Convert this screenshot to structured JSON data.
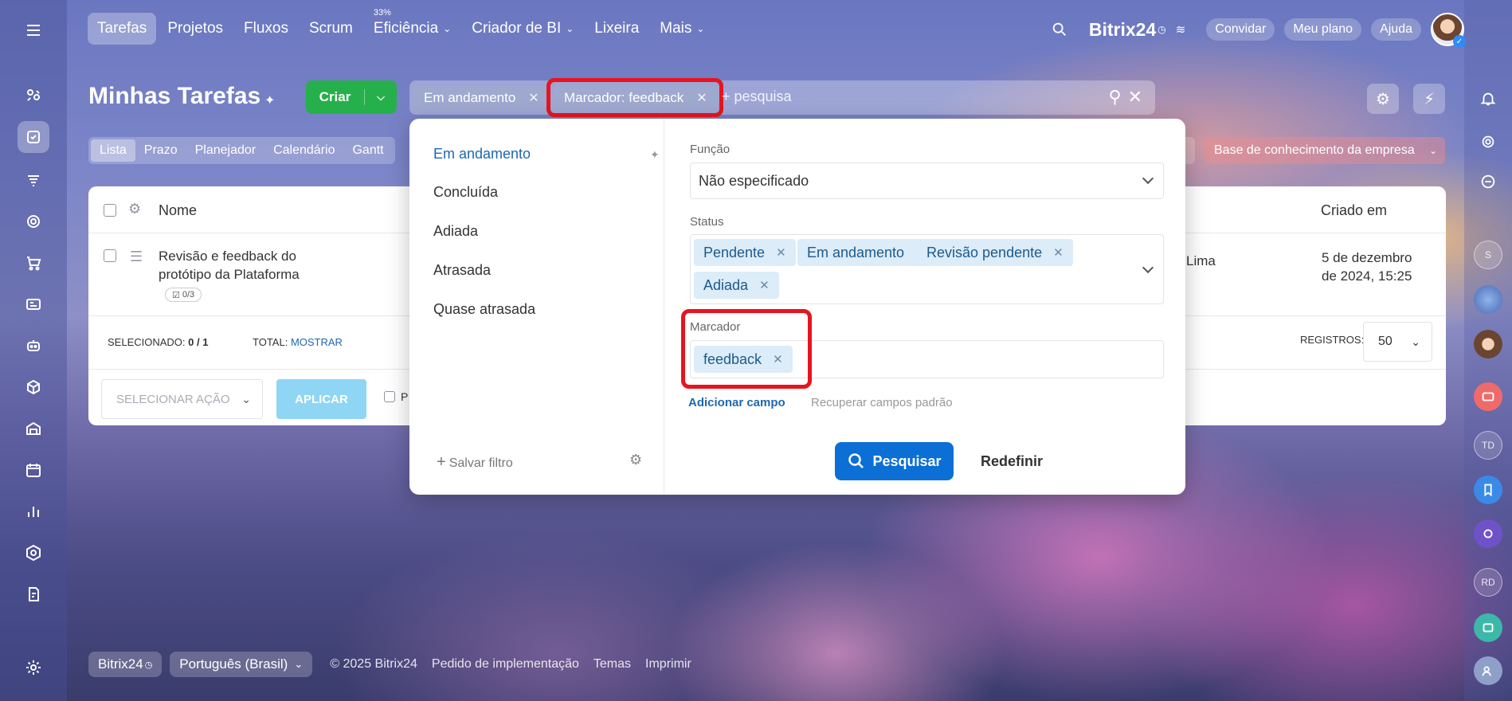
{
  "topnav": {
    "tabs": [
      {
        "label": "Tarefas",
        "active": true
      },
      {
        "label": "Projetos"
      },
      {
        "label": "Fluxos"
      },
      {
        "label": "Scrum"
      },
      {
        "label": "Eficiência",
        "sup": "33%",
        "caret": true
      },
      {
        "label": "Criador de BI",
        "caret": true
      },
      {
        "label": "Lixeira"
      },
      {
        "label": "Mais",
        "caret": true
      }
    ],
    "brand": "Bitrix24",
    "invite": "Convidar",
    "plan": "Meu plano",
    "help": "Ajuda"
  },
  "page": {
    "title": "Minhas Tarefas",
    "create": "Criar"
  },
  "filterbar": {
    "chip1": "Em andamento",
    "chip2": "Marcador: feedback",
    "placeholder": "+ pesquisa"
  },
  "viewtabs": [
    "Lista",
    "Prazo",
    "Planejador",
    "Calendário",
    "Gantt"
  ],
  "kb": "Base de conhecimento da empresa",
  "grid": {
    "col_name": "Nome",
    "col_created": "Criado em",
    "row_title_1": "Revisão e feedback do",
    "row_title_2": "protótipo da Plataforma",
    "row_subtasks": "0/3",
    "row_person": "Lima",
    "row_date_1": "5 de dezembro",
    "row_date_2": "de 2024, 15:25",
    "selected_label": "SELECIONADO:",
    "selected_value": "0 / 1",
    "total_label": "TOTAL:",
    "total_link": "MOSTRAR",
    "records_label": "REGISTROS:",
    "records_value": "50",
    "select_action": "SELECIONAR AÇÃO",
    "apply": "APLICAR",
    "partial_checkbox": "P"
  },
  "popup": {
    "presets": [
      "Em andamento",
      "Concluída",
      "Adiada",
      "Atrasada",
      "Quase atrasada"
    ],
    "save_filter": "Salvar filtro",
    "funcao_label": "Função",
    "funcao_value": "Não especificado",
    "status_label": "Status",
    "status_tags": [
      "Pendente",
      "Em andamento",
      "Revisão pendente",
      "Adiada"
    ],
    "marcador_label": "Marcador",
    "marcador_tag": "feedback",
    "add_field": "Adicionar campo",
    "restore_fields": "Recuperar campos padrão",
    "search": "Pesquisar",
    "reset": "Redefinir"
  },
  "right_bar": {
    "initials_1": "S",
    "initials_2": "TD",
    "initials_3": "RD"
  },
  "footer": {
    "brand": "Bitrix24",
    "language": "Português (Brasil)",
    "copyright": "© 2025 Bitrix24",
    "link1": "Pedido de implementação",
    "link2": "Temas",
    "link3": "Imprimir"
  },
  "colors": {
    "accent": "#0b6fd6",
    "create": "#26b04b",
    "highlight": "#e8141e"
  }
}
